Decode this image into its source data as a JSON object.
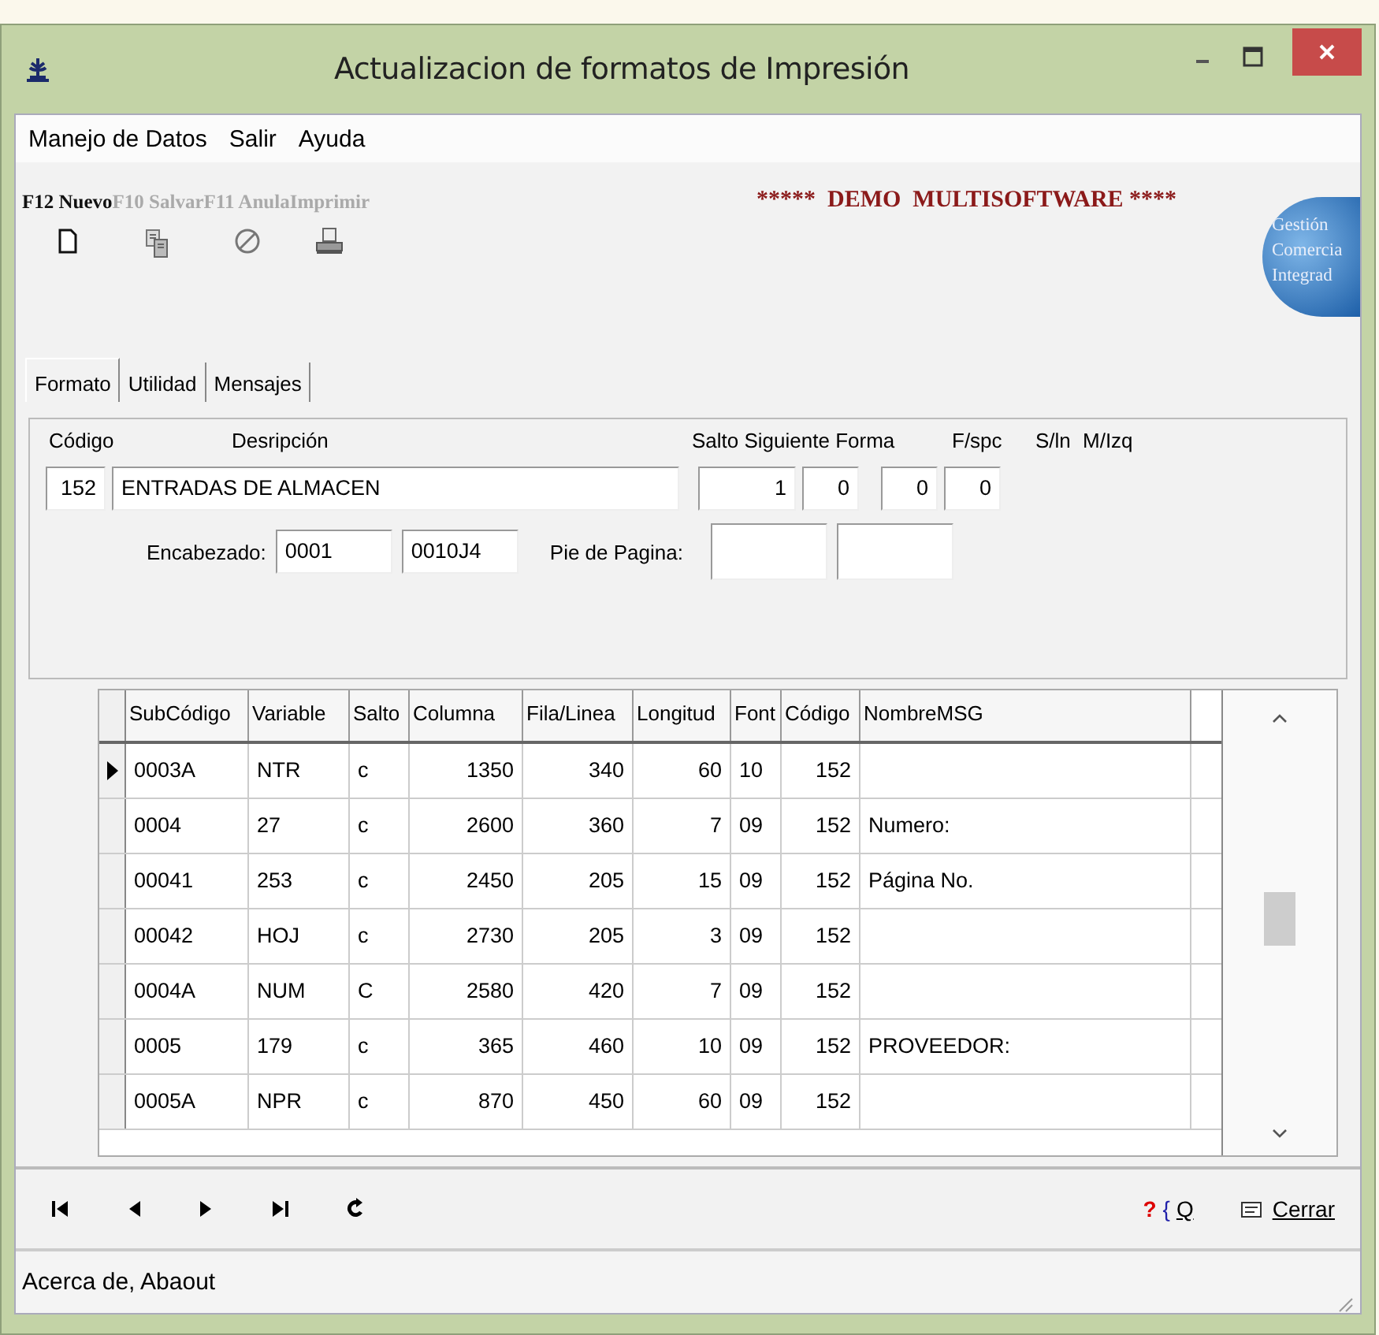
{
  "window": {
    "title": "Actualizacion de formatos de Impresión"
  },
  "menu": [
    "Manejo de Datos",
    "Salir",
    "Ayuda"
  ],
  "toolbar": [
    {
      "label": "F12 Nuevo",
      "enabled": true,
      "kind": "new"
    },
    {
      "label": "F10 Salvar",
      "enabled": false,
      "kind": "save"
    },
    {
      "label": "F11 Anula",
      "enabled": false,
      "kind": "cancel"
    },
    {
      "label": "Imprimir",
      "enabled": false,
      "kind": "print"
    }
  ],
  "banner": "*****  DEMO  MULTISOFTWARE ****",
  "logo": [
    "Gestión",
    "Comercia",
    "Integrad"
  ],
  "tabs": [
    {
      "label": "Formato",
      "selected": true
    },
    {
      "label": "Utilidad",
      "selected": false
    },
    {
      "label": "Mensajes",
      "selected": false
    }
  ],
  "form": {
    "codigo_label": "Código",
    "codigo": "152",
    "descripcion_label": "Desripción",
    "descripcion": "ENTRADAS DE ALMACEN",
    "salto_label": "Salto Siguiente Forma",
    "salto": "1",
    "fspc_label": "F/spc",
    "fspc": "0",
    "sln_label": "S/ln",
    "sln": "0",
    "mizq_label": "M/Izq",
    "mizq": "0",
    "encabezado_label": "Encabezado:",
    "encabezado": [
      "0001",
      "0010J4"
    ],
    "pie_label": "Pie de Pagina:"
  },
  "table": {
    "columns": [
      "SubCódigo",
      "Variable",
      "Salto",
      "Columna",
      "Fila/Linea",
      "Longitud",
      "Font",
      "Código",
      "NombreMSG"
    ],
    "rows": [
      {
        "selected": true,
        "cells": [
          "0003A",
          "NTR",
          "c",
          "1350",
          "340",
          "60",
          "10",
          "152",
          ""
        ]
      },
      {
        "selected": false,
        "cells": [
          "0004",
          "27",
          "c",
          "2600",
          "360",
          "7",
          "09",
          "152",
          "Numero:"
        ]
      },
      {
        "selected": false,
        "cells": [
          "00041",
          "253",
          "c",
          "2450",
          "205",
          "15",
          "09",
          "152",
          "Página No."
        ]
      },
      {
        "selected": false,
        "cells": [
          "00042",
          "HOJ",
          "c",
          "2730",
          "205",
          "3",
          "09",
          "152",
          ""
        ]
      },
      {
        "selected": false,
        "cells": [
          "0004A",
          "NUM",
          "C",
          "2580",
          "420",
          "7",
          "09",
          "152",
          ""
        ]
      },
      {
        "selected": false,
        "cells": [
          "0005",
          "179",
          "c",
          "365",
          "460",
          "10",
          "09",
          "152",
          "PROVEEDOR:"
        ]
      },
      {
        "selected": false,
        "cells": [
          "0005A",
          "NPR",
          "c",
          "870",
          "450",
          "60",
          "09",
          "152",
          ""
        ]
      }
    ]
  },
  "nav": {
    "help_mark": "?",
    "help_brace": "{",
    "help_label": "Q",
    "close_label": "Cerrar"
  },
  "status_bar": "Acerca de,  Abaout"
}
